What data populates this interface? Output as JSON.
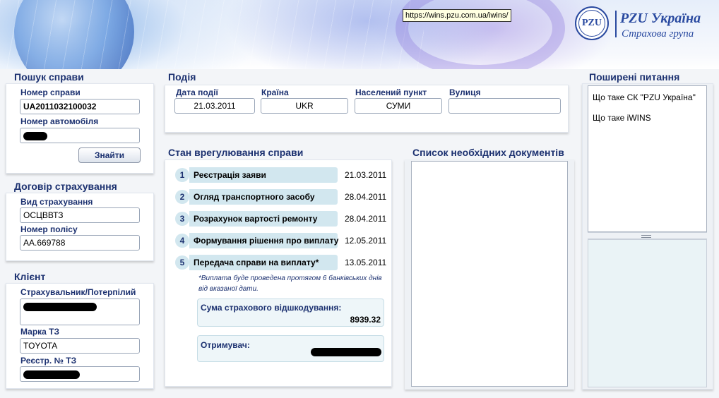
{
  "header": {
    "url_tooltip": "https://wins.pzu.com.ua/iwins/",
    "logo_seal_text": "PZU",
    "logo_name": "PZU Україна",
    "logo_subtitle": "Страхова група"
  },
  "search": {
    "title": "Пошук справи",
    "case_number_label": "Номер справи",
    "case_number_value": "UA2011032100032",
    "vehicle_number_label": "Номер автомобіля",
    "find_button": "Знайти"
  },
  "contract": {
    "title": "Договір страхування",
    "type_label": "Вид страхування",
    "type_value": "ОСЦВВТЗ",
    "policy_label": "Номер полісу",
    "policy_value": "АА.669788"
  },
  "client": {
    "title": "Клієнт",
    "insured_label": "Страхувальник/Потерпілий",
    "brand_label": "Марка ТЗ",
    "brand_value": "TOYOTA",
    "reg_label": "Реєстр. № ТЗ"
  },
  "event": {
    "title": "Подія",
    "date_label": "Дата події",
    "date_value": "21.03.2011",
    "country_label": "Країна",
    "country_value": "UKR",
    "city_label": "Населений пункт",
    "city_value": "СУМИ",
    "street_label": "Вулиця",
    "street_value": ""
  },
  "status": {
    "title": "Стан врегулювання справи",
    "steps": [
      {
        "num": "1",
        "label": "Реєстрація заяви",
        "date": "21.03.2011"
      },
      {
        "num": "2",
        "label": "Огляд транспортного засобу",
        "date": "28.04.2011"
      },
      {
        "num": "3",
        "label": "Розрахунок вартості ремонту",
        "date": "28.04.2011"
      },
      {
        "num": "4",
        "label": "Формування рішення про виплату",
        "date": "12.05.2011"
      },
      {
        "num": "5",
        "label": "Передача справи на виплату*",
        "date": "13.05.2011"
      }
    ],
    "note": "*Виплата буде проведена протягом 6 банківських днів від вказаної дати.",
    "sum_label": "Сума страхового відшкодування:",
    "sum_value": "8939.32",
    "recipient_label": "Отримувач:"
  },
  "documents": {
    "title": "Список необхідних документів"
  },
  "faq": {
    "title": "Поширені питання",
    "items": [
      "Що таке СК \"PZU Україна\"",
      "Що таке iWINS"
    ]
  }
}
